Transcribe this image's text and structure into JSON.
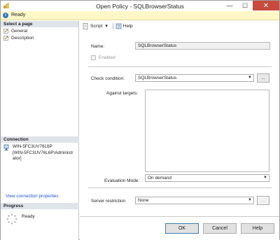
{
  "window": {
    "title": "Open Policy - SQLBrowserStatus",
    "minimize": "—",
    "maximize": "☐",
    "close": "✕"
  },
  "status": {
    "text": "Ready"
  },
  "left_pane": {
    "select_page_header": "Select a page",
    "pages": [
      {
        "label": "General",
        "icon": "page-wrench-icon"
      },
      {
        "label": "Description",
        "icon": "page-wrench-icon"
      }
    ],
    "connection_header": "Connection",
    "connection_line1": "WIN-5FC3UV76L6P",
    "connection_line2": "[WIN-5FC3UV76L6P\\Administr",
    "connection_line3": "ator]",
    "connection_link": "View connection properties",
    "progress_header": "Progress",
    "progress_status": "Ready"
  },
  "toolbar": {
    "script_label": "Script",
    "script_dropdown": "▾",
    "help_label": "Help"
  },
  "form": {
    "name_label": "Name:",
    "name_value": "SQLBrowserStatus",
    "enabled_label": "Enabled",
    "check_condition_label": "Check condition:",
    "check_condition_value": "SQLBrowserStatus",
    "against_targets_label": "Against targets:",
    "evaluation_mode_label": "Evaluation Mode:",
    "evaluation_mode_value": "On demand",
    "server_restriction_label": "Server restriction",
    "server_restriction_value": "None",
    "ellipsis": "..."
  },
  "buttons": {
    "ok": "OK",
    "cancel": "Cancel",
    "help": "Help"
  }
}
